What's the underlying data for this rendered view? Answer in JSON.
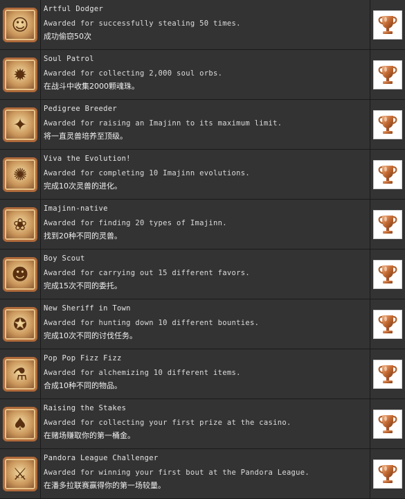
{
  "colors": {
    "background": "#333333",
    "divider": "#1a1a1a",
    "bronze": "#c46a33",
    "text": "#e6e6e6"
  },
  "trophies": [
    {
      "title": "Artful Dodger",
      "description": "Awarded for successfully stealing 50 times.",
      "chinese": "成功偷窃50次",
      "icon": "thief-character-icon",
      "glyph": "☺",
      "grade": "bronze"
    },
    {
      "title": "Soul Patrol",
      "description": "Awarded for collecting 2,000 soul orbs.",
      "chinese": "在战斗中收集2000颗魂珠。",
      "icon": "soul-orb-icon",
      "glyph": "✹",
      "grade": "bronze"
    },
    {
      "title": "Pedigree Breeder",
      "description": "Awarded for raising an Imajinn to its maximum limit.",
      "chinese": "将一直灵兽培养至顶级。",
      "icon": "imajinn-bird-icon",
      "glyph": "✦",
      "grade": "bronze"
    },
    {
      "title": "Viva the Evolution!",
      "description": "Awarded for completing 10 Imajinn evolutions.",
      "chinese": "完成10次灵兽的进化。",
      "icon": "imajinn-evolution-icon",
      "glyph": "✺",
      "grade": "bronze"
    },
    {
      "title": "Imajinn-native",
      "description": "Awarded for finding 20 types of Imajinn.",
      "chinese": "找到20种不同的灵兽。",
      "icon": "imajinn-collector-icon",
      "glyph": "❀",
      "grade": "bronze"
    },
    {
      "title": "Boy Scout",
      "description": "Awarded for carrying out 15 different favors.",
      "chinese": "完成15次不同的委托。",
      "icon": "villagers-icon",
      "glyph": "☻",
      "grade": "bronze"
    },
    {
      "title": "New Sheriff in Town",
      "description": "Awarded for hunting down 10 different bounties.",
      "chinese": "完成10次不同的讨伐任务。",
      "icon": "bounty-monster-icon",
      "glyph": "✪",
      "grade": "bronze"
    },
    {
      "title": "Pop Pop Fizz Fizz",
      "description": "Awarded for alchemizing 10 different items.",
      "chinese": "合成10种不同的物品。",
      "icon": "alchemy-cauldron-icon",
      "glyph": "⚗",
      "grade": "bronze"
    },
    {
      "title": "Raising the Stakes",
      "description": "Awarded for collecting your first prize at the casino.",
      "chinese": "在赌场赚取你的第一桶金。",
      "icon": "casino-character-icon",
      "glyph": "♠",
      "grade": "bronze"
    },
    {
      "title": "Pandora League Challenger",
      "description": "Awarded for winning your first bout at the Pandora League.",
      "chinese": "在潘多拉联赛赢得你的第一场较量。",
      "icon": "pandora-league-emblem-icon",
      "glyph": "⚔",
      "grade": "bronze"
    }
  ]
}
